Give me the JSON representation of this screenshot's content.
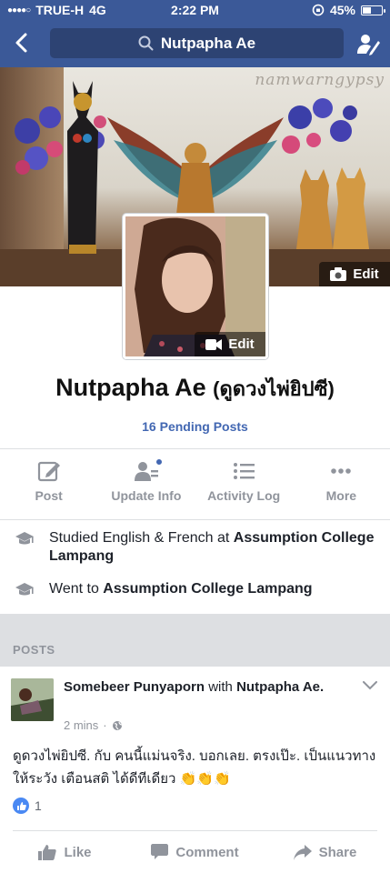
{
  "status_bar": {
    "carrier": "TRUE-H",
    "network": "4G",
    "time": "2:22 PM",
    "battery": "45%",
    "battery_level": 0.45
  },
  "nav": {
    "search_text": "Nutpapha Ae"
  },
  "cover": {
    "watermark": "namwarngypsy",
    "edit_label": "Edit"
  },
  "profile": {
    "photo_edit_label": "Edit",
    "name": "Nutpapha Ae",
    "alternate_name": "(ดูดวงไพ่ยิปซี)",
    "pending_posts": "16 Pending Posts"
  },
  "actions": [
    {
      "label": "Post",
      "icon": "edit-icon"
    },
    {
      "label": "Update Info",
      "icon": "person-lines-icon"
    },
    {
      "label": "Activity Log",
      "icon": "list-icon"
    },
    {
      "label": "More",
      "icon": "more-dots-icon"
    }
  ],
  "intro": [
    {
      "prefix": "Studied English & French at ",
      "school": "Assumption College Lampang",
      "icon": "graduation-cap-icon"
    },
    {
      "prefix": "Went to ",
      "school": "Assumption College Lampang",
      "icon": "graduation-cap-icon"
    }
  ],
  "posts_section": {
    "title": "POSTS"
  },
  "post": {
    "author": "Somebeer Punyaporn",
    "with_text": "with",
    "tagged": "Nutpapha Ae.",
    "time": "2 mins",
    "separator": "·",
    "body": "ดูดวงไพ่ยิปซี. กับ คนนี้แม่นจริง.  บอกเลย. ตรงเป๊ะ.  เป็นแนวทางให้ระวัง เตือนสติ ได้ดีทีเดียว 👏👏👏",
    "reaction_count": "1",
    "buttons": {
      "like": "Like",
      "comment": "Comment",
      "share": "Share"
    }
  },
  "colors": {
    "brand_blue": "#3b5998",
    "link_blue": "#4267b2",
    "muted_gray": "#90949c"
  }
}
